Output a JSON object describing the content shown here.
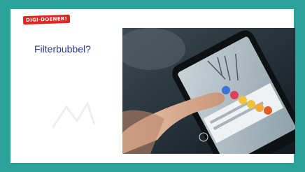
{
  "slide": {
    "badge": "DIGI-DOENER!",
    "title": "Filterbubbel?"
  },
  "colors": {
    "frame": "#2ba39b",
    "badge": "#e2261d",
    "title": "#2a3b8f"
  },
  "photo": {
    "subject": "hand-touching-smartphone-social-reactions"
  }
}
